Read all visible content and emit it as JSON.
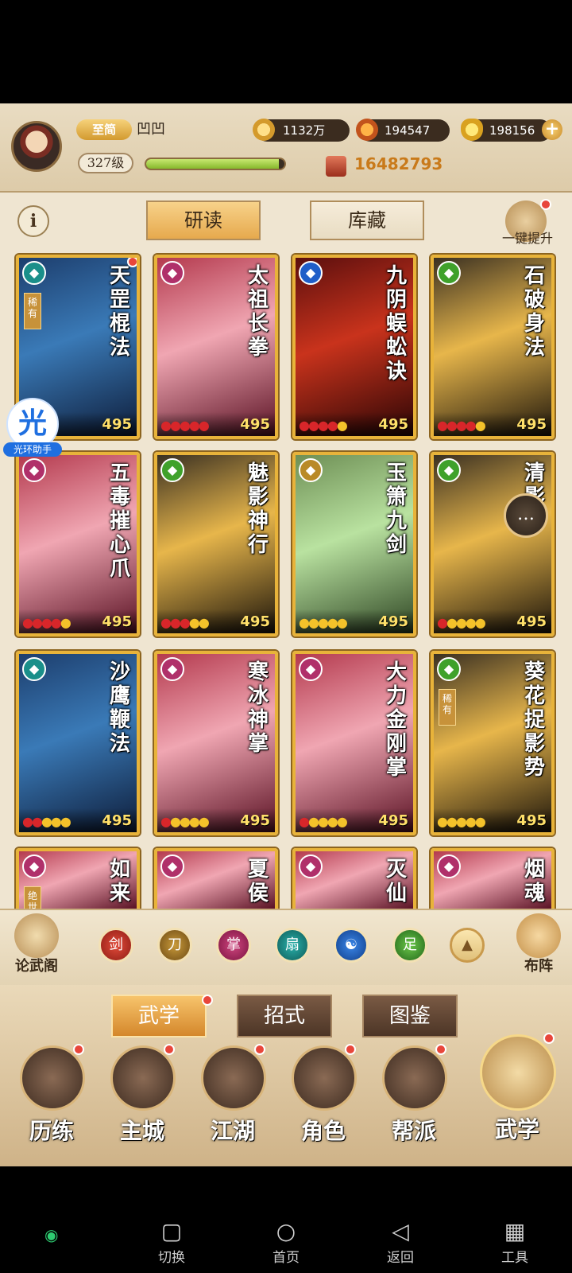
{
  "player": {
    "vip": "至简",
    "name": "凹凹",
    "level": "327级",
    "xp_fraction": 0.96,
    "power": "16482793"
  },
  "resources": [
    {
      "icon": "copper-coin-icon",
      "value": "1132万"
    },
    {
      "icon": "flame-token-icon",
      "value": "194547"
    },
    {
      "icon": "gold-ingot-icon",
      "value": "198156"
    }
  ],
  "subtabs": {
    "active": "研读",
    "inactive": "库藏"
  },
  "one_click_upgrade": "一键提升",
  "cards": [
    {
      "name": "天罡棍法",
      "element": "teal",
      "rare": "稀有",
      "level": "495",
      "red": 0,
      "gold": 0
    },
    {
      "name": "太祖长拳",
      "element": "magenta",
      "rare": "",
      "level": "495",
      "red": 5,
      "gold": 0
    },
    {
      "name": "九阴蜈蚣诀",
      "element": "blue",
      "rare": "",
      "level": "495",
      "red": 4,
      "gold": 1
    },
    {
      "name": "石破身法",
      "element": "green",
      "rare": "",
      "level": "495",
      "red": 4,
      "gold": 1
    },
    {
      "name": "五毒摧心爪",
      "element": "magenta",
      "rare": "",
      "level": "495",
      "red": 4,
      "gold": 1
    },
    {
      "name": "魅影神行",
      "element": "green",
      "rare": "",
      "level": "495",
      "red": 3,
      "gold": 2
    },
    {
      "name": "玉箫九剑",
      "element": "gold",
      "rare": "",
      "level": "495",
      "red": 0,
      "gold": 5
    },
    {
      "name": "清影步",
      "element": "green",
      "rare": "",
      "level": "495",
      "red": 1,
      "gold": 4
    },
    {
      "name": "沙鹰鞭法",
      "element": "teal",
      "rare": "",
      "level": "495",
      "red": 2,
      "gold": 3
    },
    {
      "name": "寒冰神掌",
      "element": "magenta",
      "rare": "",
      "level": "495",
      "red": 1,
      "gold": 4
    },
    {
      "name": "大力金刚掌",
      "element": "magenta",
      "rare": "",
      "level": "495",
      "red": 1,
      "gold": 4
    },
    {
      "name": "葵花捉影势",
      "element": "green",
      "rare": "稀有",
      "level": "495",
      "red": 0,
      "gold": 5
    },
    {
      "name": "如来",
      "element": "magenta",
      "rare": "绝世",
      "level": "",
      "red": 0,
      "gold": 0
    },
    {
      "name": "夏侯",
      "element": "magenta",
      "rare": "",
      "level": "",
      "red": 0,
      "gold": 0
    },
    {
      "name": "灭仙",
      "element": "magenta",
      "rare": "",
      "level": "",
      "red": 0,
      "gold": 0
    },
    {
      "name": "烟魂",
      "element": "magenta",
      "rare": "",
      "level": "",
      "red": 0,
      "gold": 0
    }
  ],
  "filter": {
    "left_label": "论武阁",
    "right_label": "布阵"
  },
  "maintabs": [
    "武学",
    "招式",
    "图鉴"
  ],
  "nav": [
    "历练",
    "主城",
    "江湖",
    "角色",
    "帮派",
    "武学"
  ],
  "helper": {
    "icon_char": "光",
    "label": "光环助手"
  },
  "system": [
    "切换",
    "首页",
    "返回",
    "工具"
  ],
  "colors": {
    "red_drop": "#d8262a",
    "gold_drop": "#f4c22a",
    "teal": "#1a8f8a",
    "magenta": "#b0306a",
    "blue": "#1f5ec8",
    "green": "#3fa12b",
    "gold": "#b98a28"
  }
}
